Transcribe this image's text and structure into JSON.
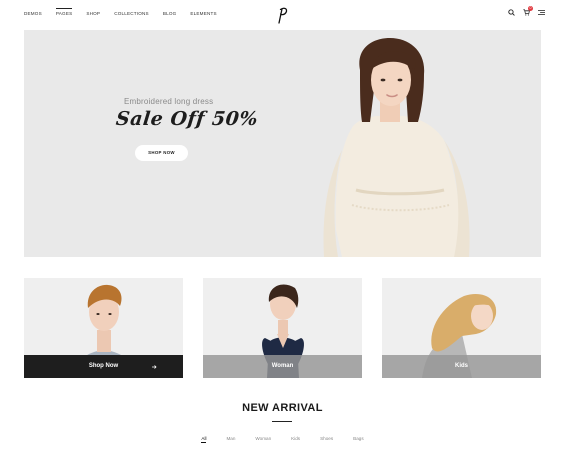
{
  "nav": {
    "items": [
      {
        "label": "DEMOS"
      },
      {
        "label": "PAGES"
      },
      {
        "label": "SHOP"
      },
      {
        "label": "COLLECTIONS"
      },
      {
        "label": "BLOG"
      },
      {
        "label": "ELEMENTS"
      }
    ],
    "cart_count": "0"
  },
  "hero": {
    "subtitle": "Embroidered long dress",
    "title": "Sale Off 50%",
    "button_label": "SHOP NOW"
  },
  "categories": [
    {
      "label": "Shop Now"
    },
    {
      "label": "Woman"
    },
    {
      "label": "Kids"
    }
  ],
  "new_arrival": {
    "title": "NEW ARRIVAL",
    "filters": [
      "All",
      "Man",
      "Woman",
      "Kids",
      "Shoes",
      "Bags"
    ]
  },
  "colors": {
    "accent": "#e0383e",
    "hero_bg": "#e9e9e9",
    "dark_bar": "#1e1e1e"
  }
}
